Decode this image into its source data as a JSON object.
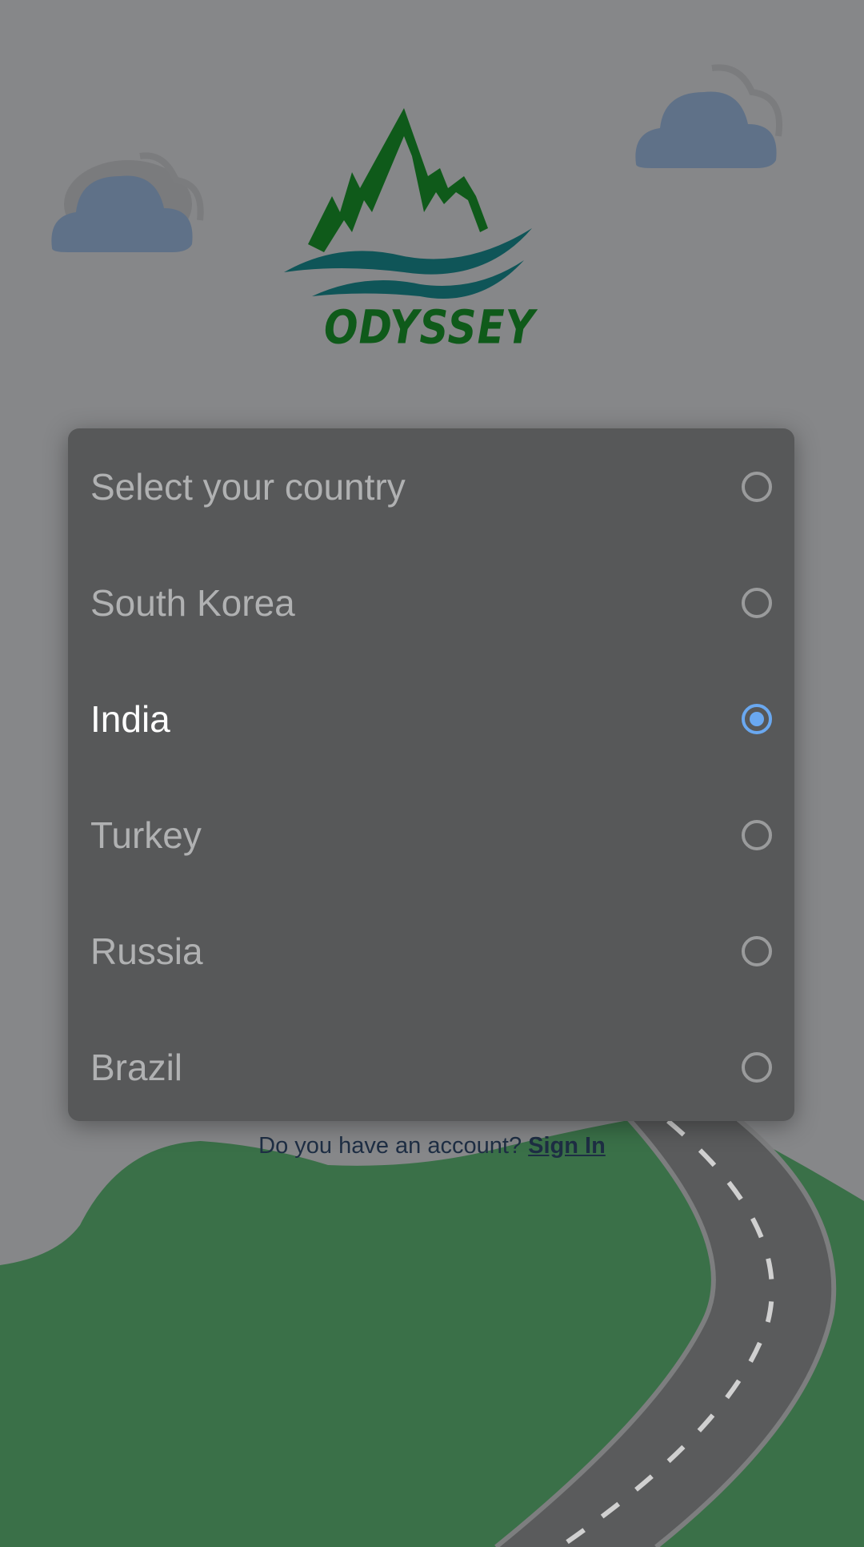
{
  "app": {
    "logo_text": "ODYSSEY"
  },
  "country_dialog": {
    "selected_index": 2,
    "options": [
      {
        "label": "Select your country"
      },
      {
        "label": "South Korea"
      },
      {
        "label": "India"
      },
      {
        "label": "Turkey"
      },
      {
        "label": "Russia"
      },
      {
        "label": "Brazil"
      }
    ]
  },
  "signin": {
    "prompt": "Do you have an account?",
    "link_label": "Sign In"
  },
  "colors": {
    "accent": "#6aa8f0",
    "logo_green": "#0f5a1a",
    "logo_teal": "#0f5558",
    "grass": "#3a7048",
    "road": "#5a5b5c"
  }
}
